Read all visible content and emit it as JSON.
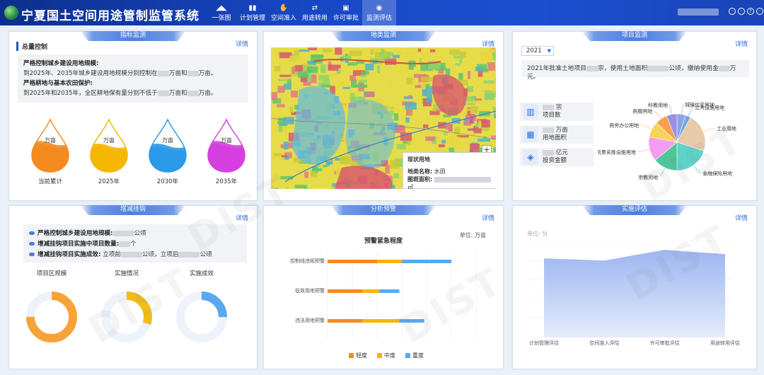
{
  "header": {
    "title": "宁夏国土空间用途管制监管系统",
    "nav": [
      {
        "label": "一张图",
        "icon": "map-fold-icon"
      },
      {
        "label": "计划管理",
        "icon": "bar-chart-icon"
      },
      {
        "label": "空间准入",
        "icon": "hand-icon"
      },
      {
        "label": "用途转用",
        "icon": "transfer-icon"
      },
      {
        "label": "许可审批",
        "icon": "approval-icon"
      },
      {
        "label": "监测评估",
        "icon": "eye-icon"
      }
    ],
    "active_nav": 5
  },
  "common": {
    "detail": "详情"
  },
  "indicator": {
    "title": "指标监测",
    "section": "总量控制",
    "h1": "严格控制城乡建设用地规模:",
    "p1a": "到2025年、2035年城乡建设用地规模分别控制在",
    "p1b": "万亩和",
    "p1c": "万亩。",
    "h2": "严格耕地与基本农田保护:",
    "p2a": "到2025年和2035年，全区耕地保有量分别不低于",
    "p2b": "万亩和",
    "p2c": "万亩。",
    "unit": "万亩",
    "drops": [
      {
        "label": "当前累计",
        "color": "#f58a1f",
        "level": 0.55
      },
      {
        "label": "2025年",
        "color": "#f5b600",
        "level": 0.5
      },
      {
        "label": "2030年",
        "color": "#2b9ae8",
        "level": 0.5
      },
      {
        "label": "2035年",
        "color": "#d640e0",
        "level": 0.55
      }
    ]
  },
  "landtype": {
    "title": "地类监测",
    "popup_title": "现状用地",
    "popup_type_label": "地类名称:",
    "popup_type_value": "水田",
    "popup_area_label": "图斑面积:",
    "popup_area_unit": "㎡",
    "zoom_in": "+"
  },
  "project": {
    "title": "项目监测",
    "year": "2021",
    "summary_a": "2021年批准土地项目",
    "summary_b": "宗，使用土地面积",
    "summary_c": "公顷，缴纳使用金",
    "summary_d": "万元。",
    "stats": [
      {
        "value_unit": "宗",
        "label": "项目数",
        "icon": "books-icon"
      },
      {
        "value_unit": "万亩",
        "label": "用地面积",
        "icon": "building-icon"
      },
      {
        "value_unit": "亿元",
        "label": "投资金额",
        "icon": "money-bag-icon"
      }
    ],
    "pie": {
      "labels": [
        "城镇住宅用地",
        "公共设施用地",
        "工业用地",
        "金融保险用地",
        "宗教用地",
        "风景名胜设施用地",
        "商务办公用地",
        "商服用地",
        "科教用地"
      ],
      "colors": [
        "#8ea3e8",
        "#6fa6e8",
        "#e8c9a8",
        "#5fd3c9",
        "#4fc69a",
        "#f49df0",
        "#f7d35a",
        "#f9a04d",
        "#9b8ee6"
      ],
      "values": [
        5,
        3,
        22,
        20,
        14,
        14,
        9,
        7,
        6
      ]
    }
  },
  "increase": {
    "title": "增减挂钩",
    "l1a": "严格控制城乡建设用地规模:",
    "l1b": "公顷",
    "l2a": "增减挂钩项目实施中项目数量:",
    "l2b": "个",
    "l3a": "增减挂钩项目实施成效:",
    "l3b": "立项前",
    "l3c": "公顷，立项后",
    "l3d": "公顷",
    "rings": [
      {
        "label": "项目区规模",
        "color": "#f7a33a",
        "fraction": 0.75
      },
      {
        "label": "实施情况",
        "color": "#f2bd1a",
        "fraction": 0.3
      },
      {
        "label": "实施成效",
        "color": "#5aa8ef",
        "fraction": 0.25
      }
    ]
  },
  "warning": {
    "title": "分析预警",
    "chart_data": {
      "type": "bar",
      "title": "预警紧急程度",
      "unit_label": "单位: 万亩",
      "categories": [
        "控制线违规预警",
        "低效用地预警",
        "违法用地预警"
      ],
      "series": [
        {
          "name": "轻度",
          "color": "#f58a1f",
          "values": [
            20,
            14,
            14
          ]
        },
        {
          "name": "中度",
          "color": "#f5b600",
          "values": [
            10,
            7,
            15
          ]
        },
        {
          "name": "重度",
          "color": "#5aa8ef",
          "values": [
            20,
            8,
            10
          ]
        }
      ],
      "xlim": [
        0,
        60
      ]
    }
  },
  "evaluation": {
    "title": "实施评估",
    "chart_data": {
      "type": "area",
      "unit_label": "单位: 分",
      "categories": [
        "计划管理评估",
        "空间准入评估",
        "许可审批评估",
        "用途转用评估"
      ],
      "values": [
        74,
        72,
        82,
        78
      ],
      "ylim": [
        0,
        90
      ]
    }
  },
  "watermark": "DIST"
}
